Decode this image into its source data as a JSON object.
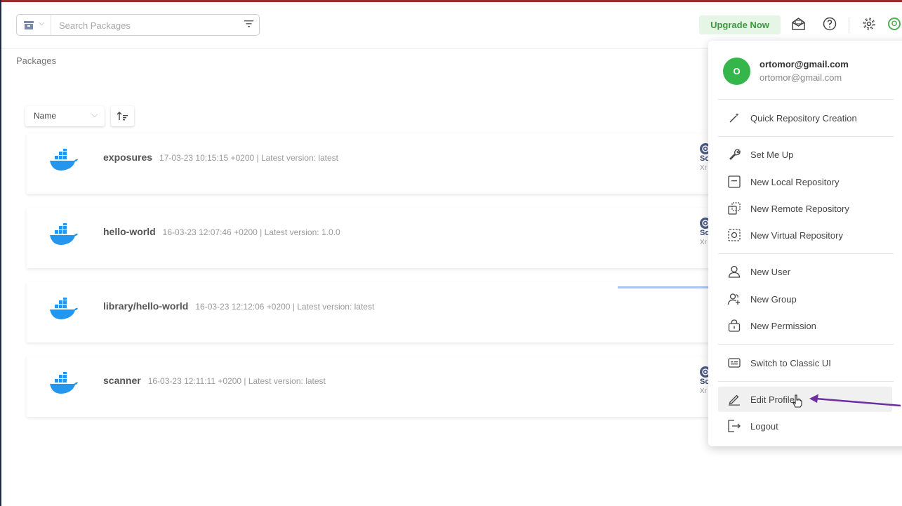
{
  "search": {
    "placeholder": "Search Packages"
  },
  "header": {
    "upgrade_label": "Upgrade Now",
    "avatar_initial": "O"
  },
  "page": {
    "title": "Packages"
  },
  "sort": {
    "field_label": "Name"
  },
  "packages": [
    {
      "name": "exposures",
      "meta": "17-03-23 10:15:15 +0200 | Latest version: latest",
      "xray_label": "Sc",
      "xray_sub": "Xr"
    },
    {
      "name": "hello-world",
      "meta": "16-03-23 12:07:46 +0200 | Latest version: 1.0.0",
      "xray_label": "Sc",
      "xray_sub": "Xr"
    },
    {
      "name": "library/hello-world",
      "meta": "16-03-23 12:12:06 +0200 | Latest version: latest"
    },
    {
      "name": "scanner",
      "meta": "16-03-23 12:11:11 +0200 | Latest version: latest",
      "xray_label": "Sc",
      "xray_sub": "Xr"
    }
  ],
  "user_menu": {
    "avatar_initial": "O",
    "email": "ortomor@gmail.com",
    "email_secondary": "ortomor@gmail.com",
    "items": [
      {
        "label": "Quick Repository Creation",
        "icon": "magic-wand-icon"
      },
      {
        "label": "Set Me Up",
        "icon": "wrench-icon"
      },
      {
        "label": "New Local Repository",
        "icon": "local-repo-icon"
      },
      {
        "label": "New Remote Repository",
        "icon": "remote-repo-icon"
      },
      {
        "label": "New Virtual Repository",
        "icon": "virtual-repo-icon"
      },
      {
        "label": "New User",
        "icon": "user-icon"
      },
      {
        "label": "New Group",
        "icon": "group-icon"
      },
      {
        "label": "New Permission",
        "icon": "lock-icon"
      },
      {
        "label": "Switch to Classic UI",
        "icon": "classic-ui-icon"
      },
      {
        "label": "Edit Profile",
        "icon": "pencil-icon"
      },
      {
        "label": "Logout",
        "icon": "logout-icon"
      }
    ]
  },
  "colors": {
    "accent_green": "#34b64a",
    "upgrade_bg": "#e6f6e6",
    "docker_blue": "#2496ed",
    "annotation_arrow": "#6b2fa0"
  }
}
